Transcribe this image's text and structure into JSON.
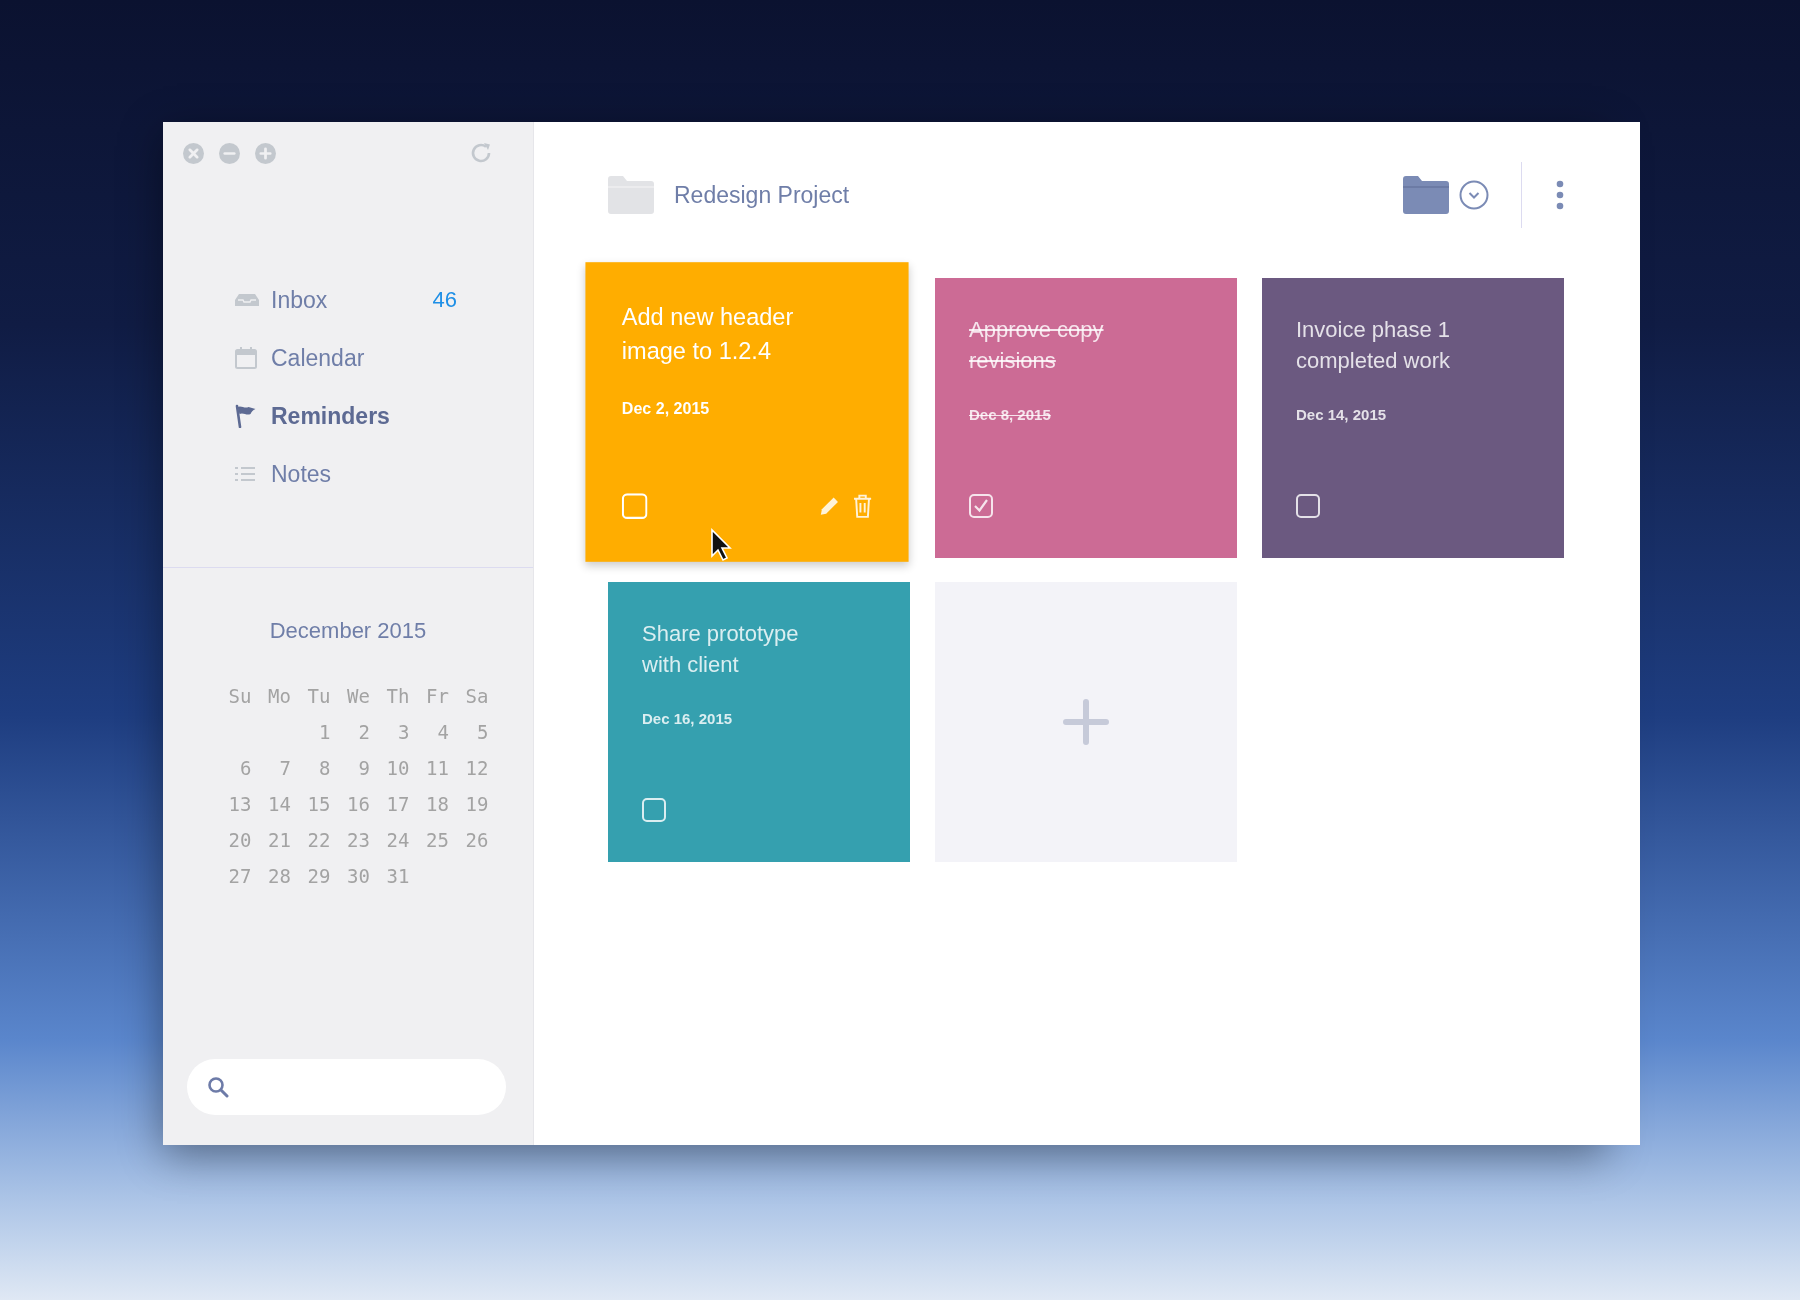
{
  "sidebar": {
    "nav": [
      {
        "label": "Inbox",
        "kind": "inbox",
        "selected": false,
        "count": "46"
      },
      {
        "label": "Calendar",
        "kind": "calendar",
        "selected": false
      },
      {
        "label": "Reminders",
        "kind": "reminders",
        "selected": true
      },
      {
        "label": "Notes",
        "kind": "notes",
        "selected": false
      }
    ],
    "calendar": {
      "title": "December 2015",
      "weekdays": [
        "Su",
        "Mo",
        "Tu",
        "We",
        "Th",
        "Fr",
        "Sa"
      ],
      "weeks": [
        {
          "kind": "starting",
          "days": [
            "1",
            "2",
            "3",
            "4",
            "5"
          ]
        },
        {
          "kind": "full",
          "days": [
            "6",
            "7",
            "8",
            "9",
            "10",
            "11",
            "12"
          ]
        },
        {
          "kind": "full",
          "days": [
            "13",
            "14",
            "15",
            "16",
            "17",
            "18",
            "19"
          ]
        },
        {
          "kind": "full",
          "days": [
            "20",
            "21",
            "22",
            "23",
            "24",
            "25",
            "26"
          ]
        },
        {
          "kind": "ending",
          "days": [
            "27",
            "28",
            "29",
            "30",
            "31"
          ]
        }
      ]
    }
  },
  "header": {
    "title": "Redesign Project"
  },
  "cards": [
    {
      "title": "Add new header image to 1.2.4",
      "date": "Dec 2, 2015",
      "checked": false,
      "hovered": true,
      "color": "#ffad00"
    },
    {
      "title": "Approve copy revisions",
      "date": "Dec 8, 2015",
      "checked": true,
      "hovered": false,
      "color": "#cc6b95"
    },
    {
      "title": "Invoice phase 1 completed work",
      "date": "Dec 14, 2015",
      "checked": false,
      "hovered": false,
      "color": "#6b5980"
    },
    {
      "title": "Share prototype with client",
      "date": "Dec 16, 2015",
      "checked": false,
      "hovered": false,
      "color": "#35a0af"
    }
  ]
}
